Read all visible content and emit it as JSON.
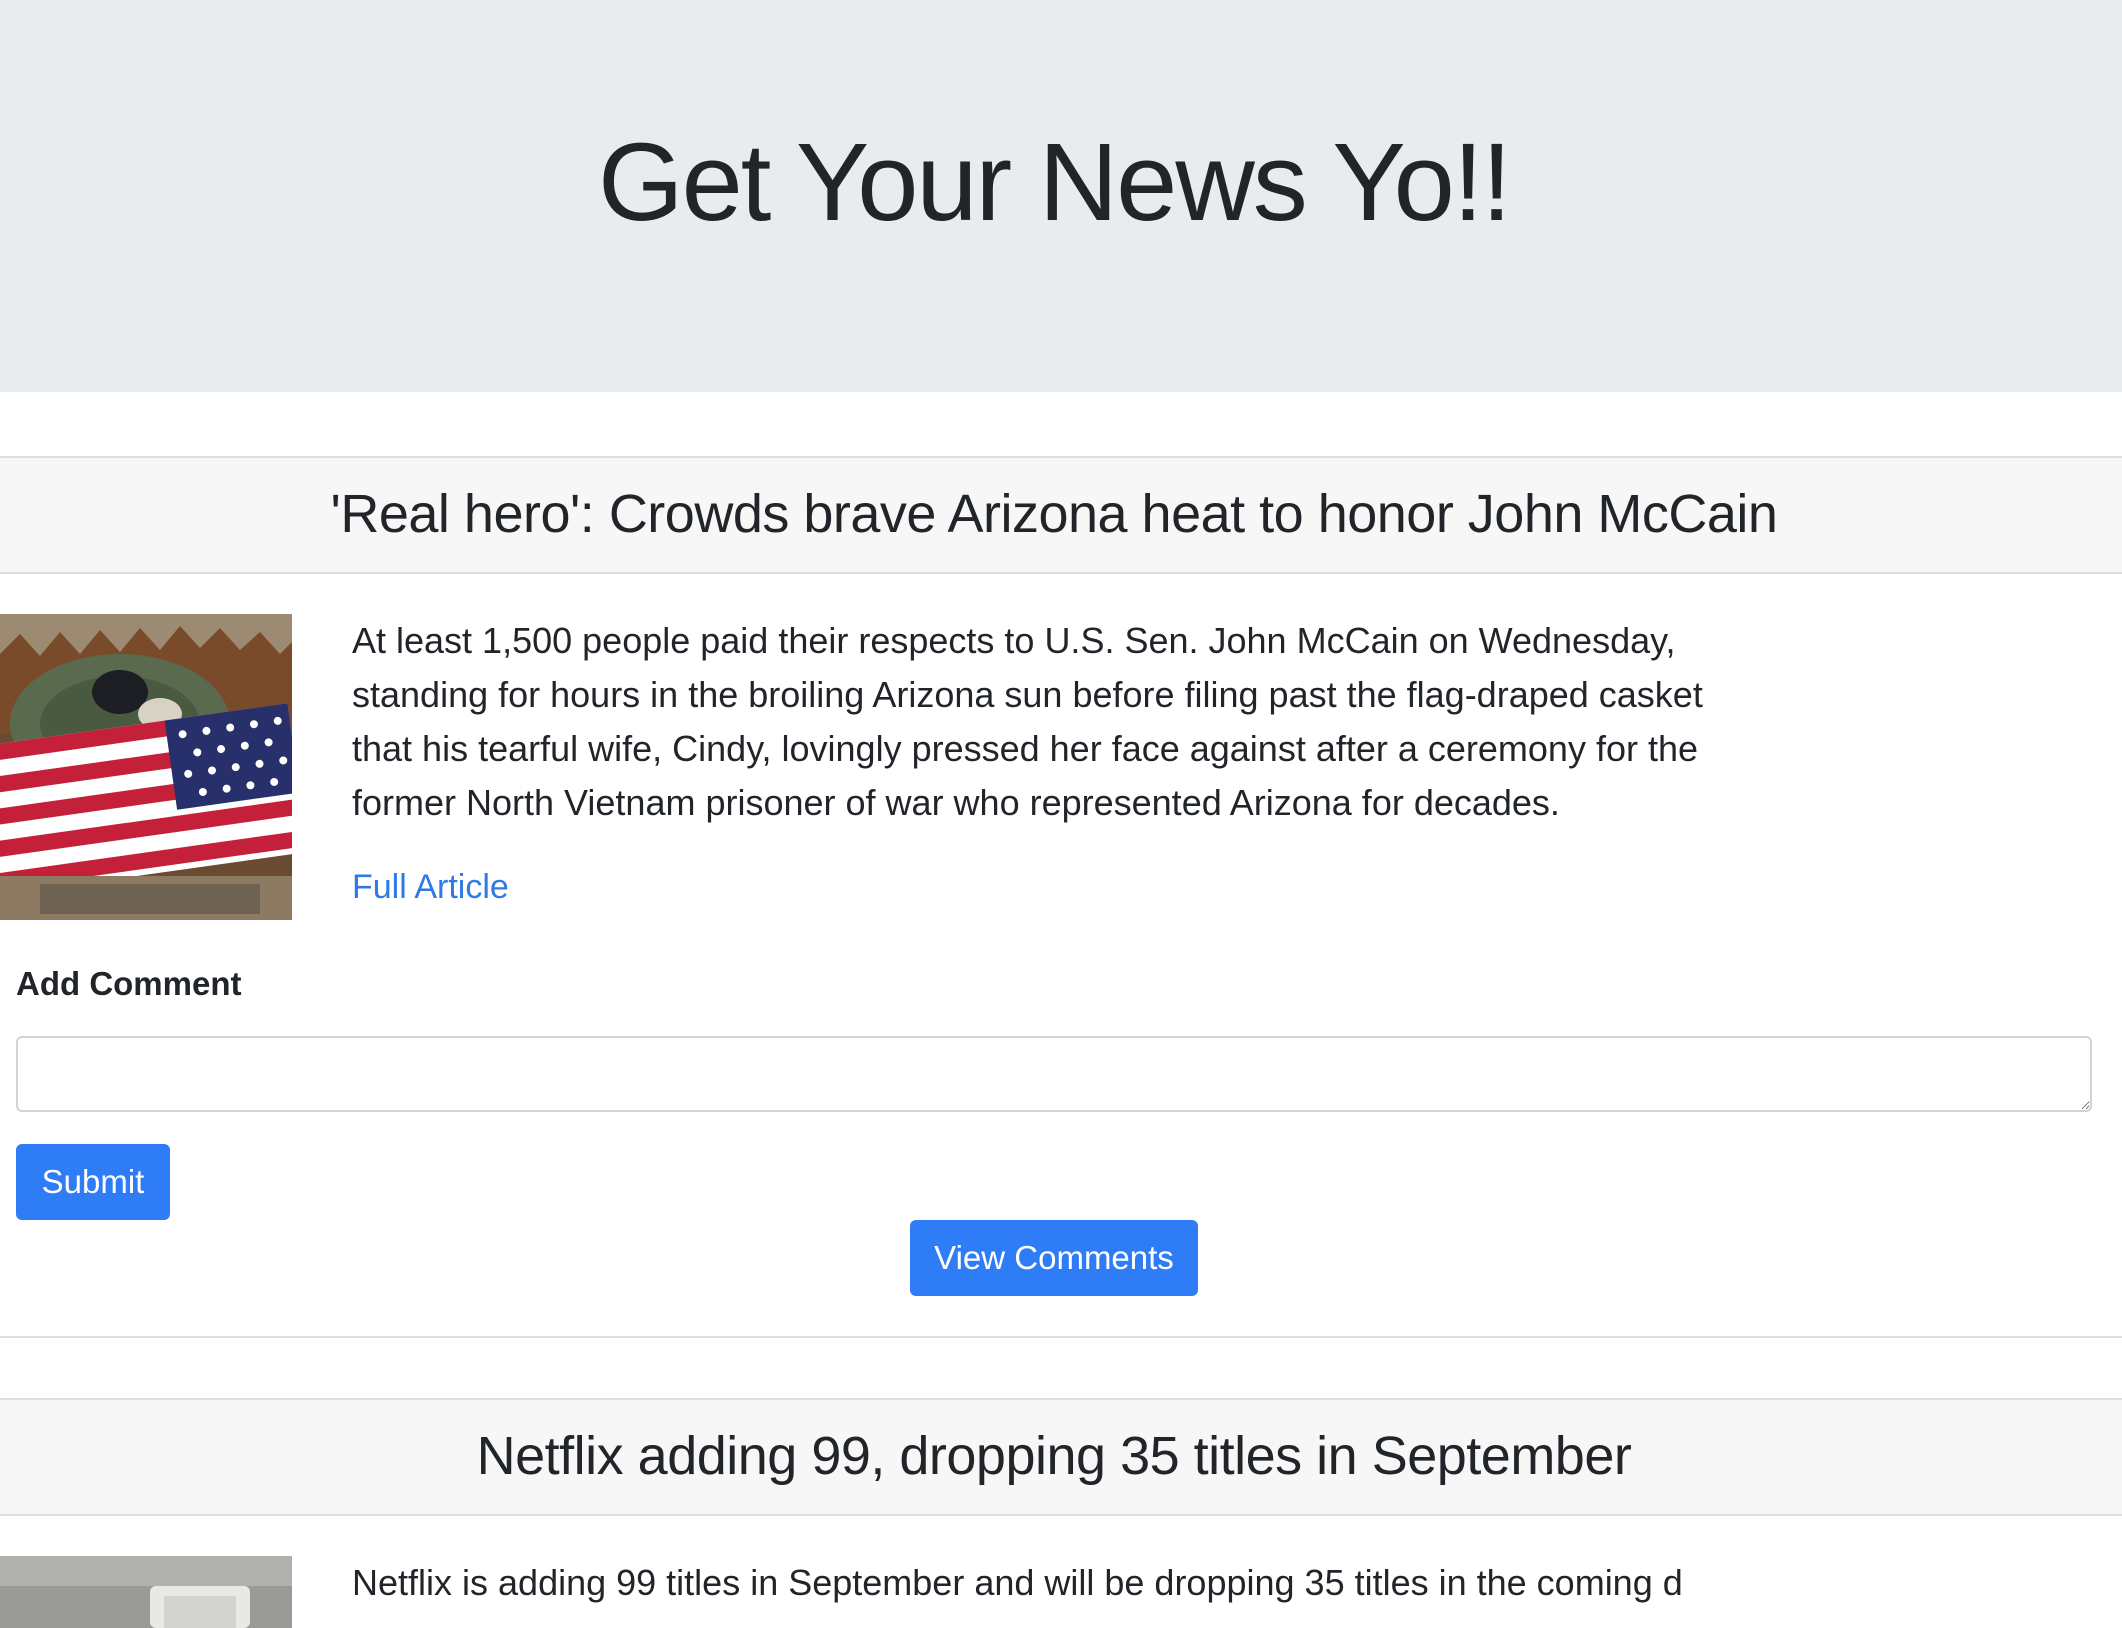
{
  "header": {
    "title": "Get Your News Yo!!"
  },
  "articles": [
    {
      "headline": "'Real hero': Crowds brave Arizona heat to honor John McCain",
      "summary": "At least 1,500 people paid their respects to U.S. Sen. John McCain on Wednesday, standing for hours in the broiling Arizona sun before filing past the flag-draped casket that his tearful wife, Cindy, lovingly pressed her face against after a ceremony for the former North Vietnam prisoner of war who represented Arizona for decades.",
      "link_label": "Full Article",
      "comment_label": "Add Comment",
      "comment_value": "",
      "submit_label": "Submit",
      "view_comments_label": "View Comments"
    },
    {
      "headline": "Netflix adding 99, dropping 35 titles in September",
      "summary": "Netflix is adding 99 titles in September and will be dropping 35 titles in the coming d"
    }
  ],
  "colors": {
    "jumbotron_bg": "#e9ecef",
    "card_header_bg": "#f7f7f7",
    "primary": "#2f7df6",
    "link": "#2f7ae5"
  }
}
